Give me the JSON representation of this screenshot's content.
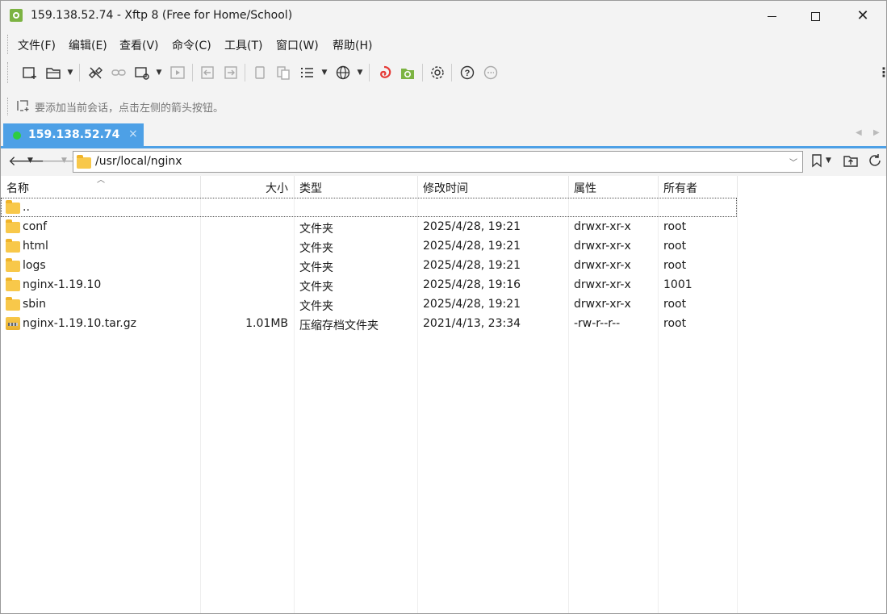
{
  "window": {
    "title": "159.138.52.74 - Xftp 8 (Free for Home/School)",
    "min_glyph": "—",
    "max_glyph": "□",
    "close_glyph": "✕"
  },
  "menu": [
    "文件(F)",
    "编辑(E)",
    "查看(V)",
    "命令(C)",
    "工具(T)",
    "窗口(W)",
    "帮助(H)"
  ],
  "toolbar": {
    "icons": [
      "new-session-icon",
      "open-folder-icon",
      "disconnect-icon",
      "reconnect-icon",
      "new-window-icon",
      "play-icon",
      "transfer-left-icon",
      "transfer-right-icon",
      "copy-icon",
      "paste-icon",
      "list-view-icon",
      "globe-icon",
      "xshell-icon",
      "xftp-icon",
      "settings-icon",
      "help-icon",
      "chat-icon"
    ]
  },
  "hint": {
    "text": "要添加当前会话，点击左侧的箭头按钮。"
  },
  "tab": {
    "label": "159.138.52.74",
    "status_color": "#2ecc40",
    "close_glyph": "×"
  },
  "address": {
    "path": "/usr/local/nginx"
  },
  "columns": {
    "name": "名称",
    "size": "大小",
    "type": "类型",
    "modified": "修改时间",
    "attributes": "属性",
    "owner": "所有者"
  },
  "files": [
    {
      "name": "..",
      "size": "",
      "type": "",
      "modified": "",
      "attributes": "",
      "owner": "",
      "icon": "folder-icon"
    },
    {
      "name": "conf",
      "size": "",
      "type": "文件夹",
      "modified": "2025/4/28, 19:21",
      "attributes": "drwxr-xr-x",
      "owner": "root",
      "icon": "folder-icon"
    },
    {
      "name": "html",
      "size": "",
      "type": "文件夹",
      "modified": "2025/4/28, 19:21",
      "attributes": "drwxr-xr-x",
      "owner": "root",
      "icon": "folder-icon"
    },
    {
      "name": "logs",
      "size": "",
      "type": "文件夹",
      "modified": "2025/4/28, 19:21",
      "attributes": "drwxr-xr-x",
      "owner": "root",
      "icon": "folder-icon"
    },
    {
      "name": "nginx-1.19.10",
      "size": "",
      "type": "文件夹",
      "modified": "2025/4/28, 19:16",
      "attributes": "drwxr-xr-x",
      "owner": "1001",
      "icon": "folder-icon"
    },
    {
      "name": "sbin",
      "size": "",
      "type": "文件夹",
      "modified": "2025/4/28, 19:21",
      "attributes": "drwxr-xr-x",
      "owner": "root",
      "icon": "folder-icon"
    },
    {
      "name": "nginx-1.19.10.tar.gz",
      "size": "1.01MB",
      "type": "压缩存档文件夹",
      "modified": "2021/4/13, 23:34",
      "attributes": "-rw-r--r--",
      "owner": "root",
      "icon": "archive-icon"
    }
  ],
  "colors": {
    "accent": "#4da0e6",
    "folder": "#f8c84a"
  }
}
